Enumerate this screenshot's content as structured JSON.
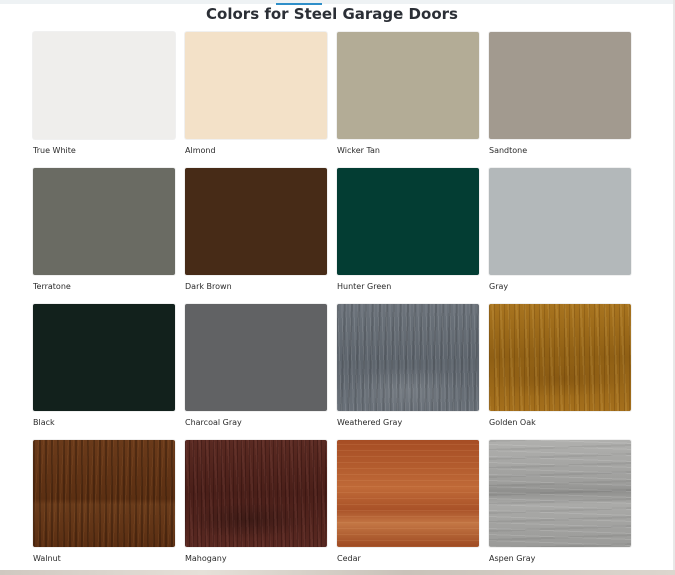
{
  "page": {
    "title": "Colors for Steel Garage Doors"
  },
  "colors": [
    {
      "label": "True White",
      "hex": "#efeeec",
      "texture": "solid"
    },
    {
      "label": "Almond",
      "hex": "#f3e1c8",
      "texture": "solid"
    },
    {
      "label": "Wicker Tan",
      "hex": "#b3ac96",
      "texture": "solid"
    },
    {
      "label": "Sandtone",
      "hex": "#a29a8f",
      "texture": "solid"
    },
    {
      "label": "Terratone",
      "hex": "#6a6b63",
      "texture": "solid"
    },
    {
      "label": "Dark Brown",
      "hex": "#472b17",
      "texture": "solid"
    },
    {
      "label": "Hunter Green",
      "hex": "#033d33",
      "texture": "solid"
    },
    {
      "label": "Gray",
      "hex": "#b3b8ba",
      "texture": "solid"
    },
    {
      "label": "Black",
      "hex": "#12211c",
      "texture": "solid"
    },
    {
      "label": "Charcoal Gray",
      "hex": "#616264",
      "texture": "solid"
    },
    {
      "label": "Weathered Gray",
      "hex": "#666d75",
      "texture": "wood-weathered"
    },
    {
      "label": "Golden Oak",
      "hex": "#9b6819",
      "texture": "wood-golden"
    },
    {
      "label": "Walnut",
      "hex": "#5e3214",
      "texture": "wood-walnut"
    },
    {
      "label": "Mahogany",
      "hex": "#50231d",
      "texture": "wood-mahogany"
    },
    {
      "label": "Cedar",
      "hex": "#b05a2c",
      "texture": "wood-cedar"
    },
    {
      "label": "Aspen Gray",
      "hex": "#a0a09e",
      "texture": "wood-aspen"
    }
  ]
}
